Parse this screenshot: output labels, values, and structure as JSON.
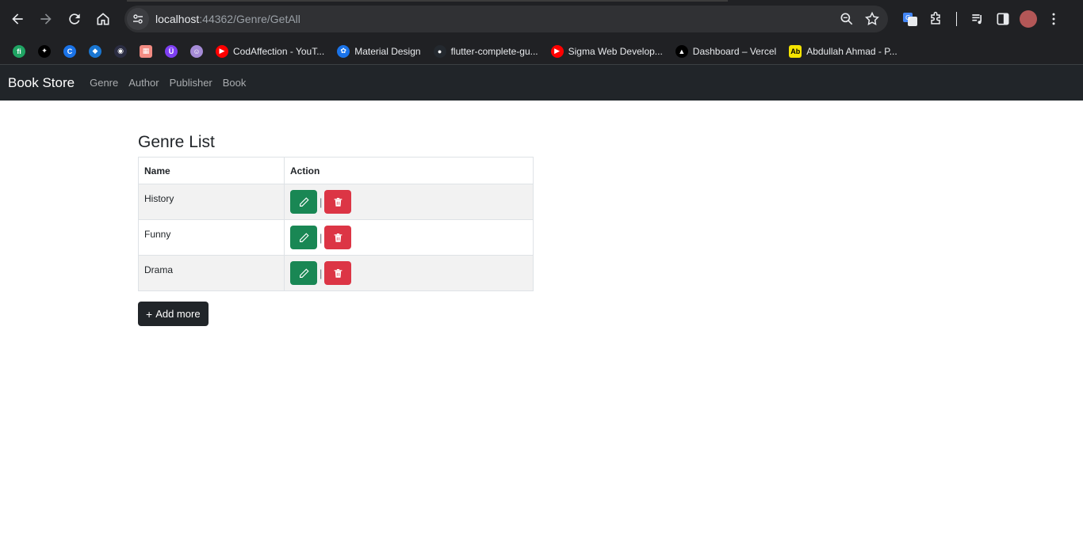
{
  "browser": {
    "url_host": "localhost",
    "url_path": ":44362/Genre/GetAll",
    "bookmarks": [
      {
        "label": "",
        "color": "#1fa463",
        "glyph": "fi"
      },
      {
        "label": "",
        "color": "#000000",
        "glyph": "✦"
      },
      {
        "label": "",
        "color": "#1a73e8",
        "glyph": "C"
      },
      {
        "label": "",
        "color": "#1976d2",
        "glyph": "◆"
      },
      {
        "label": "",
        "color": "#2b2d42",
        "glyph": "◉"
      },
      {
        "label": "",
        "color": "#f28b82",
        "glyph": "▦"
      },
      {
        "label": "",
        "color": "#7e3ff2",
        "glyph": "Ü"
      },
      {
        "label": "",
        "color": "#a58bd6",
        "glyph": "☺"
      },
      {
        "label": "CodAffection - YouT...",
        "color": "#ff0000",
        "glyph": "▶"
      },
      {
        "label": "Material Design",
        "color": "#1a73e8",
        "glyph": "✿"
      },
      {
        "label": "flutter-complete-gu...",
        "color": "#24292f",
        "glyph": "●"
      },
      {
        "label": "Sigma Web Develop...",
        "color": "#ff0000",
        "glyph": "▶"
      },
      {
        "label": "Dashboard – Vercel",
        "color": "#000000",
        "glyph": "▲"
      },
      {
        "label": "Abdullah Ahmad - P...",
        "color": "#f5e400",
        "glyph": "Ab"
      }
    ]
  },
  "navbar": {
    "brand": "Book Store",
    "links": [
      "Genre",
      "Author",
      "Publisher",
      "Book"
    ]
  },
  "main": {
    "title": "Genre List",
    "columns": [
      "Name",
      "Action"
    ],
    "rows": [
      {
        "name": "History"
      },
      {
        "name": "Funny"
      },
      {
        "name": "Drama"
      }
    ],
    "separator": "|",
    "add_label": "Add more",
    "add_icon": "+"
  }
}
